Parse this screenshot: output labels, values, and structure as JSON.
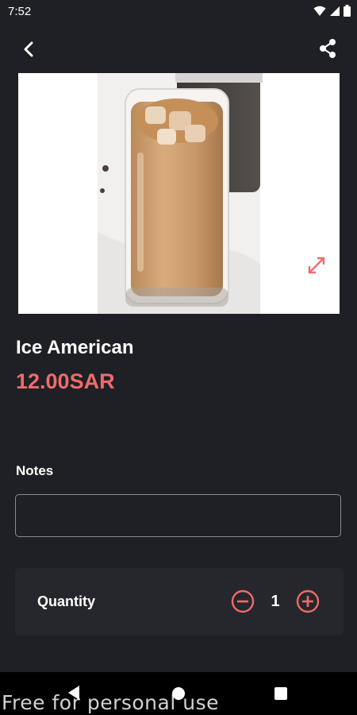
{
  "status_bar": {
    "time": "7:52",
    "icons": [
      "wifi-icon",
      "signal-icon",
      "battery-icon"
    ]
  },
  "app_bar": {
    "back_icon": "chevron-left-icon",
    "share_icon": "share-icon"
  },
  "product": {
    "image_alt": "iced coffee in tall glass",
    "name": "Ice American",
    "price": "12.00SAR",
    "expand_icon": "expand-icon"
  },
  "notes": {
    "label": "Notes",
    "value": "",
    "placeholder": ""
  },
  "quantity": {
    "label": "Quantity",
    "value": "1",
    "minus_icon": "minus-circle-icon",
    "plus_icon": "plus-circle-icon"
  },
  "nav_bar": {
    "icons": [
      "nav-back-icon",
      "nav-home-icon",
      "nav-recents-icon"
    ]
  },
  "watermark": "Free for personal use",
  "colors": {
    "background": "#1f2025",
    "card": "#26272c",
    "accent": "#ef6b6b",
    "text": "#ffffff",
    "border": "#8a8b90"
  }
}
